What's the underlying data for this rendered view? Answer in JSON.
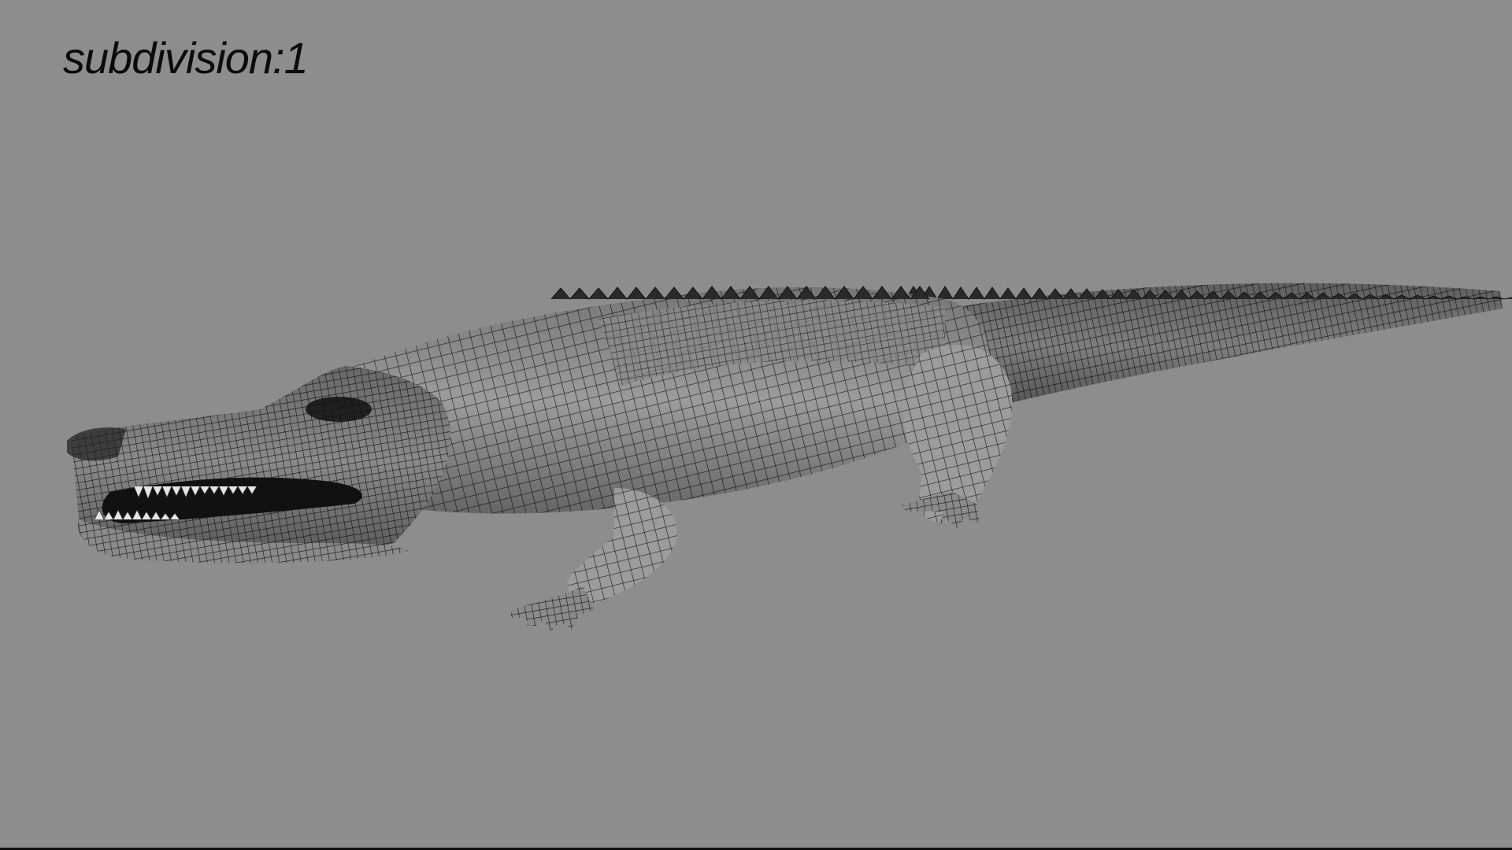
{
  "viewport": {
    "overlay_label": "subdivision:1",
    "background_color": "#8d8d8d",
    "wire_color": "#1a1a1a",
    "shade_color": "#9a9a9a"
  },
  "model": {
    "icon": "alligator-wireframe-mesh",
    "display_mode": "wireframe-on-shaded"
  }
}
